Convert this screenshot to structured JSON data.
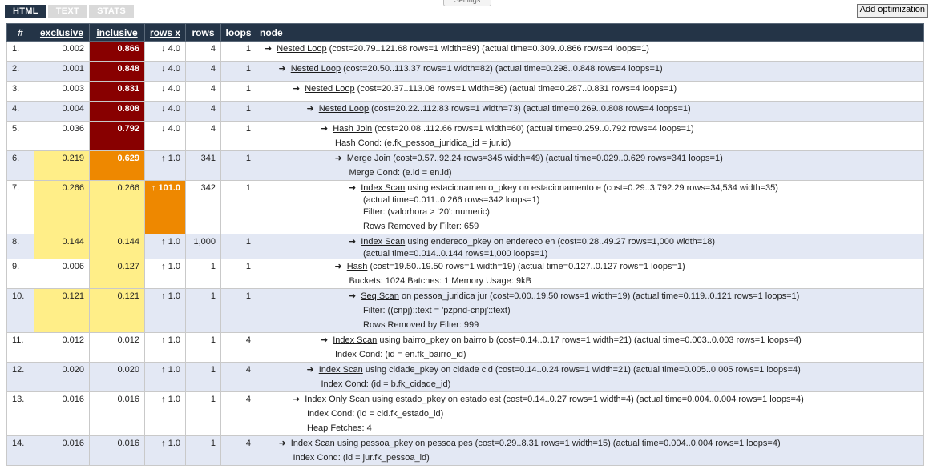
{
  "tabs": [
    "HTML",
    "TEXT",
    "STATS"
  ],
  "settings_label": "Settings",
  "add_optimization_label": "Add optimization",
  "columns": [
    "#",
    "exclusive",
    "inclusive",
    "rows x",
    "rows",
    "loops",
    "node"
  ],
  "colors": {
    "header_bg": "#243447",
    "severity_high": "#880000",
    "severity_mid": "#ee8800",
    "severity_low": "#ffee88",
    "row_alt": "#e3e8f4"
  },
  "rows": [
    {
      "num": "1.",
      "exclusive": "0.002",
      "inclusive": "0.866",
      "rows_x": "↓ 4.0",
      "rows": "4",
      "loops": "1",
      "indent": 0,
      "op": "Nested Loop",
      "details": "(cost=20.79..121.68 rows=1 width=89) (actual time=0.309..0.866 rows=4 loops=1)",
      "extra": [],
      "excl_sev": "",
      "incl_sev": "high",
      "rx_sev": ""
    },
    {
      "num": "2.",
      "exclusive": "0.001",
      "inclusive": "0.848",
      "rows_x": "↓ 4.0",
      "rows": "4",
      "loops": "1",
      "indent": 1,
      "op": "Nested Loop",
      "details": "(cost=20.50..113.37 rows=1 width=82) (actual time=0.298..0.848 rows=4 loops=1)",
      "extra": [],
      "excl_sev": "",
      "incl_sev": "high",
      "rx_sev": ""
    },
    {
      "num": "3.",
      "exclusive": "0.003",
      "inclusive": "0.831",
      "rows_x": "↓ 4.0",
      "rows": "4",
      "loops": "1",
      "indent": 2,
      "op": "Nested Loop",
      "details": "(cost=20.37..113.08 rows=1 width=86) (actual time=0.287..0.831 rows=4 loops=1)",
      "extra": [],
      "excl_sev": "",
      "incl_sev": "high",
      "rx_sev": ""
    },
    {
      "num": "4.",
      "exclusive": "0.004",
      "inclusive": "0.808",
      "rows_x": "↓ 4.0",
      "rows": "4",
      "loops": "1",
      "indent": 3,
      "op": "Nested Loop",
      "details": "(cost=20.22..112.83 rows=1 width=73) (actual time=0.269..0.808 rows=4 loops=1)",
      "extra": [],
      "excl_sev": "",
      "incl_sev": "high",
      "rx_sev": ""
    },
    {
      "num": "5.",
      "exclusive": "0.036",
      "inclusive": "0.792",
      "rows_x": "↓ 4.0",
      "rows": "4",
      "loops": "1",
      "indent": 4,
      "op": "Hash Join",
      "details": "(cost=20.08..112.66 rows=1 width=60) (actual time=0.259..0.792 rows=4 loops=1)",
      "extra": [
        "Hash Cond: (e.fk_pessoa_juridica_id = jur.id)"
      ],
      "excl_sev": "",
      "incl_sev": "high",
      "rx_sev": ""
    },
    {
      "num": "6.",
      "exclusive": "0.219",
      "inclusive": "0.629",
      "rows_x": "↑ 1.0",
      "rows": "341",
      "loops": "1",
      "indent": 5,
      "op": "Merge Join",
      "details": "(cost=0.57..92.24 rows=345 width=49) (actual time=0.029..0.629 rows=341 loops=1)",
      "extra": [
        "Merge Cond: (e.id = en.id)"
      ],
      "excl_sev": "low",
      "incl_sev": "mid",
      "rx_sev": ""
    },
    {
      "num": "7.",
      "exclusive": "0.266",
      "inclusive": "0.266",
      "rows_x": "↑ 101.0",
      "rows": "342",
      "loops": "1",
      "indent": 6,
      "op": "Index Scan",
      "details": "using estacionamento_pkey on estacionamento e (cost=0.29..3,792.29 rows=34,534 width=35)",
      "details2": "(actual time=0.011..0.266 rows=342 loops=1)",
      "extra": [
        "Filter: (valorhora > '20'::numeric)",
        "Rows Removed by Filter: 659"
      ],
      "excl_sev": "low",
      "incl_sev": "low",
      "rx_sev": "mid"
    },
    {
      "num": "8.",
      "exclusive": "0.144",
      "inclusive": "0.144",
      "rows_x": "↑ 1.0",
      "rows": "1,000",
      "loops": "1",
      "indent": 6,
      "op": "Index Scan",
      "details": "using endereco_pkey on endereco en (cost=0.28..49.27 rows=1,000 width=18)",
      "details2": "(actual time=0.014..0.144 rows=1,000 loops=1)",
      "extra": [],
      "excl_sev": "low",
      "incl_sev": "low",
      "rx_sev": ""
    },
    {
      "num": "9.",
      "exclusive": "0.006",
      "inclusive": "0.127",
      "rows_x": "↑ 1.0",
      "rows": "1",
      "loops": "1",
      "indent": 5,
      "op": "Hash",
      "details": "(cost=19.50..19.50 rows=1 width=19) (actual time=0.127..0.127 rows=1 loops=1)",
      "extra": [
        "Buckets: 1024 Batches: 1 Memory Usage: 9kB"
      ],
      "excl_sev": "",
      "incl_sev": "low",
      "rx_sev": ""
    },
    {
      "num": "10.",
      "exclusive": "0.121",
      "inclusive": "0.121",
      "rows_x": "↑ 1.0",
      "rows": "1",
      "loops": "1",
      "indent": 6,
      "op": "Seq Scan",
      "details": "on pessoa_juridica jur (cost=0.00..19.50 rows=1 width=19) (actual time=0.119..0.121 rows=1 loops=1)",
      "extra": [
        "Filter: ((cnpj)::text = 'pzpnd-cnpj'::text)",
        "Rows Removed by Filter: 999"
      ],
      "excl_sev": "low",
      "incl_sev": "low",
      "rx_sev": ""
    },
    {
      "num": "11.",
      "exclusive": "0.012",
      "inclusive": "0.012",
      "rows_x": "↑ 1.0",
      "rows": "1",
      "loops": "4",
      "indent": 4,
      "op": "Index Scan",
      "details": "using bairro_pkey on bairro b (cost=0.14..0.17 rows=1 width=21) (actual time=0.003..0.003 rows=1 loops=4)",
      "extra": [
        "Index Cond: (id = en.fk_bairro_id)"
      ],
      "excl_sev": "",
      "incl_sev": "",
      "rx_sev": ""
    },
    {
      "num": "12.",
      "exclusive": "0.020",
      "inclusive": "0.020",
      "rows_x": "↑ 1.0",
      "rows": "1",
      "loops": "4",
      "indent": 3,
      "op": "Index Scan",
      "details": "using cidade_pkey on cidade cid (cost=0.14..0.24 rows=1 width=21) (actual time=0.005..0.005 rows=1 loops=4)",
      "extra": [
        "Index Cond: (id = b.fk_cidade_id)"
      ],
      "excl_sev": "",
      "incl_sev": "",
      "rx_sev": ""
    },
    {
      "num": "13.",
      "exclusive": "0.016",
      "inclusive": "0.016",
      "rows_x": "↑ 1.0",
      "rows": "1",
      "loops": "4",
      "indent": 2,
      "op": "Index Only Scan",
      "details": "using estado_pkey on estado est (cost=0.14..0.27 rows=1 width=4) (actual time=0.004..0.004 rows=1 loops=4)",
      "extra": [
        "Index Cond: (id = cid.fk_estado_id)",
        "Heap Fetches: 4"
      ],
      "excl_sev": "",
      "incl_sev": "",
      "rx_sev": ""
    },
    {
      "num": "14.",
      "exclusive": "0.016",
      "inclusive": "0.016",
      "rows_x": "↑ 1.0",
      "rows": "1",
      "loops": "4",
      "indent": 1,
      "op": "Index Scan",
      "details": "using pessoa_pkey on pessoa pes (cost=0.29..8.31 rows=1 width=15) (actual time=0.004..0.004 rows=1 loops=4)",
      "extra": [
        "Index Cond: (id = jur.fk_pessoa_id)"
      ],
      "excl_sev": "",
      "incl_sev": "",
      "rx_sev": ""
    }
  ]
}
